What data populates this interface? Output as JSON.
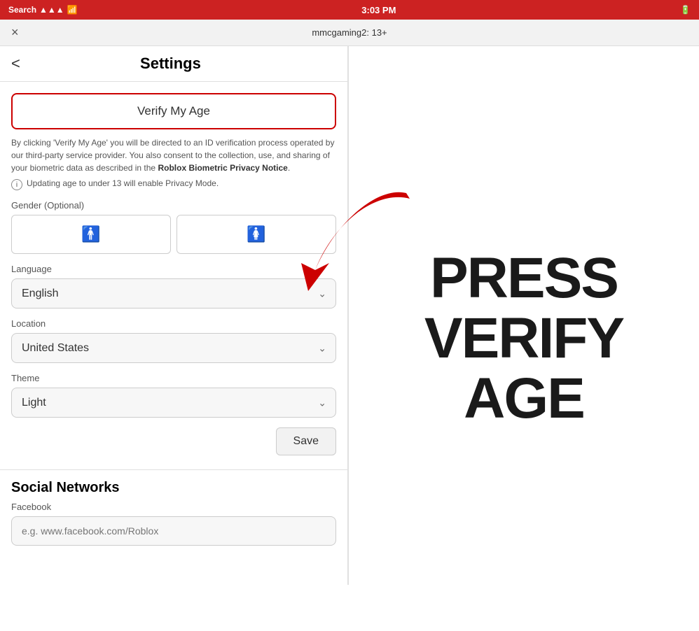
{
  "statusBar": {
    "carrier": "Search",
    "time": "3:03 PM",
    "icons": "signals"
  },
  "browserChrome": {
    "closeLabel": "×",
    "urlText": "mmcgaming2: 13+"
  },
  "settings": {
    "backLabel": "<",
    "title": "Settings",
    "verifyAgeButton": "Verify My Age",
    "verifyDesc": "By clicking 'Verify My Age' you will be directed to an ID verification process operated by our third-party service provider. You also consent to the collection, use, and sharing of your biometric data as described in the",
    "privacyLink": "Roblox Biometric Privacy Notice",
    "privacyNote": "Updating age to under 13 will enable Privacy Mode.",
    "genderLabel": "Gender (Optional)",
    "maleIcon": "♟",
    "femaleIcon": "♀",
    "languageLabel": "Language",
    "languageValue": "English",
    "locationLabel": "Location",
    "locationValue": "United States",
    "themeLabel": "Theme",
    "themeValue": "Light",
    "saveButton": "Save",
    "socialNetworksTitle": "Social Networks",
    "facebookLabel": "Facebook",
    "facebookPlaceholder": "e.g. www.facebook.com/Roblox"
  },
  "overlay": {
    "line1": "PRESS",
    "line2": "VERIFY",
    "line3": "AGE"
  }
}
